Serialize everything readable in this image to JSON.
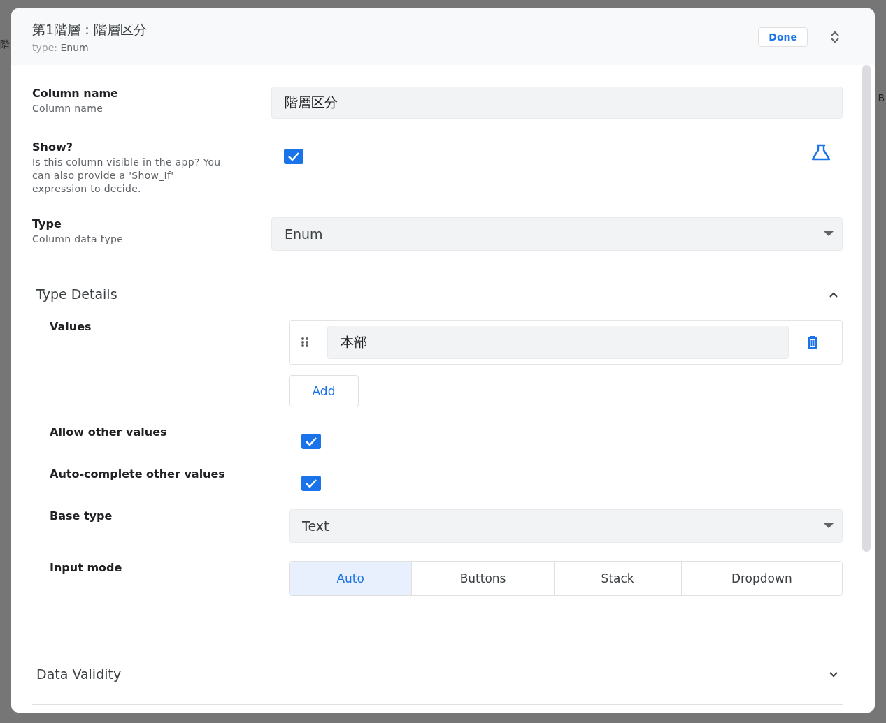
{
  "background": {
    "left_text": "階",
    "right_text": "B"
  },
  "header": {
    "title": "第1階層：階層区分",
    "subtitle_label": "type:",
    "subtitle_value": "Enum",
    "done_button": "Done"
  },
  "fields": [
    {
      "kind": "text",
      "label": "Column name",
      "description": "Column name",
      "value": "階層区分"
    },
    {
      "kind": "checkbox",
      "label": "Show?",
      "description": "Is this column visible in the app? You can also provide a 'Show_If' expression to decide.",
      "checked": true,
      "formula": true
    },
    {
      "kind": "dropdown",
      "label": "Type",
      "description": "Column data type",
      "value": "Enum"
    }
  ],
  "sections": [
    {
      "title": "Type Details",
      "expanded": true,
      "fields": [
        {
          "kind": "list",
          "label": "Values",
          "items": [
            "本部"
          ],
          "add_button": "Add"
        },
        {
          "kind": "checkbox",
          "label": "Allow other values",
          "checked": true
        },
        {
          "kind": "checkbox",
          "label": "Auto-complete other values",
          "checked": true
        },
        {
          "kind": "dropdown",
          "label": "Base type",
          "value": "Text"
        },
        {
          "kind": "segmented",
          "label": "Input mode",
          "options": [
            {
              "label": "Auto",
              "selected": true
            },
            {
              "label": "Buttons",
              "selected": false
            },
            {
              "label": "Stack",
              "selected": false
            },
            {
              "label": "Dropdown",
              "selected": false
            }
          ]
        }
      ]
    },
    {
      "title": "Data Validity",
      "expanded": false
    }
  ]
}
